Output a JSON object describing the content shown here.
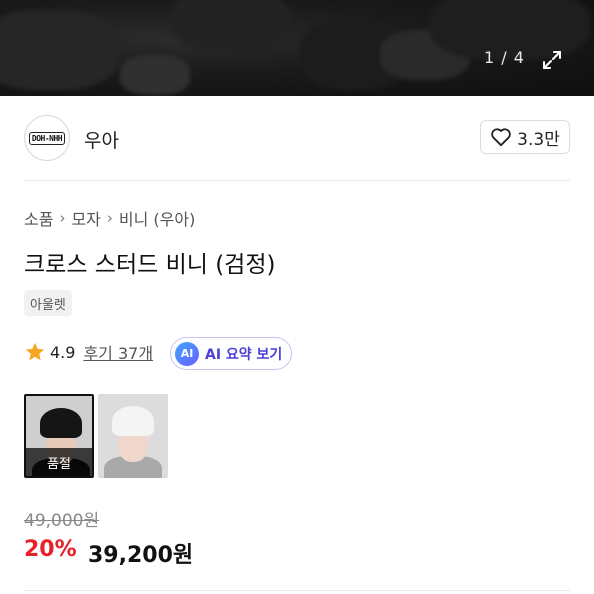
{
  "gallery": {
    "counter": "1 / 4",
    "expand_icon": "expand-icon"
  },
  "brand": {
    "logo_text": "DOH-NHH",
    "name": "우아",
    "like_icon": "heart-outline-icon",
    "like_count": "3.3만"
  },
  "breadcrumb": [
    "소품",
    "모자",
    "비니 (우아)"
  ],
  "product": {
    "title": "크로스 스터드 비니 (검정)",
    "tag": "아울렛",
    "rating": "4.9",
    "reviews": "후기 37개",
    "ai_badge": "AI",
    "ai_summary_label": "AI 요약 보기"
  },
  "thumbnails": [
    {
      "color": "black",
      "status": "품절",
      "selected": true
    },
    {
      "color": "white",
      "status": "",
      "selected": false
    }
  ],
  "price": {
    "original": "49,000원",
    "discount": "20%",
    "final": "39,200원",
    "discount_color": "#e8202a"
  },
  "colors": {
    "ai_accent": "#4a3fd8",
    "star": "#f5a623"
  }
}
